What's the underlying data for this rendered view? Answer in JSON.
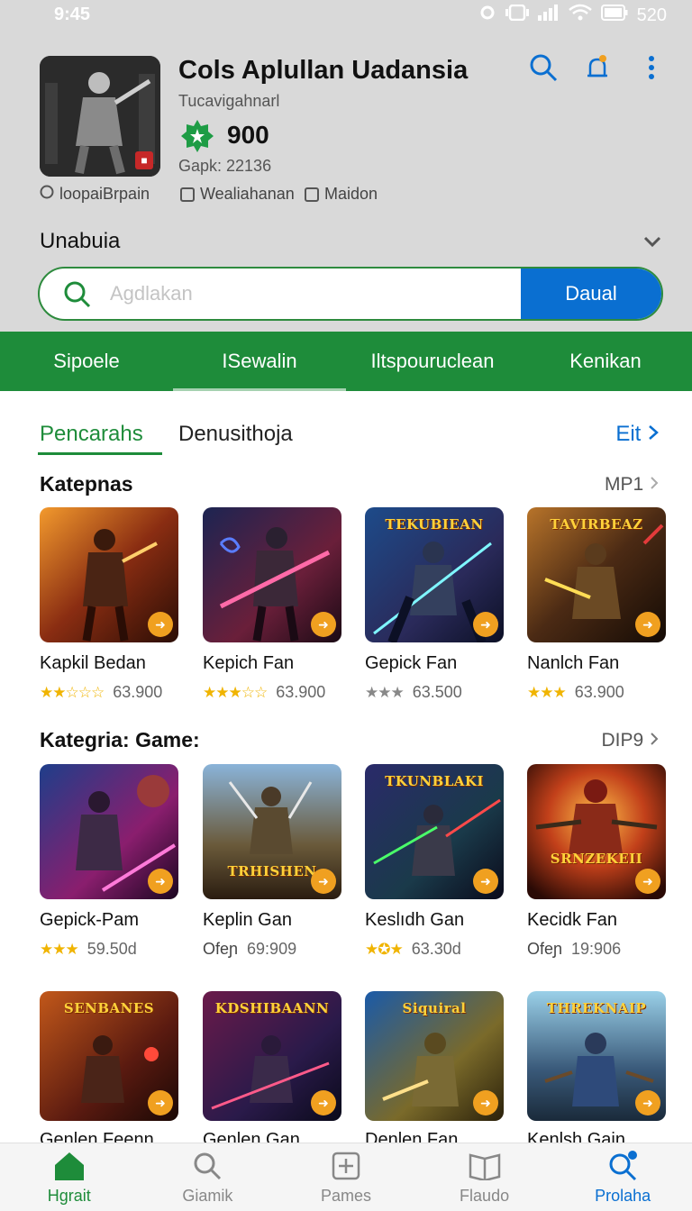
{
  "status_bar": {
    "time": "9:45",
    "battery": "520"
  },
  "app": {
    "title": "Cols Aplullan Uadansia",
    "developer": "Tucavigahnarl",
    "rating": "900",
    "size": "Gapk: 22136",
    "meta_left": "loopaiBrpain",
    "meta_mid": "Wealiahanan",
    "meta_right": "Maidon"
  },
  "header_icons": [
    "search-icon",
    "notification-bell-icon",
    "more-vert-icon"
  ],
  "section_dropdown": {
    "label": "Unabuia"
  },
  "search": {
    "placeholder": "Agdlakan",
    "button_label": "Daual"
  },
  "nav_strip": {
    "items": [
      {
        "label": "Sipoele"
      },
      {
        "label": "ISewalin"
      },
      {
        "label": "Iltspouruclean"
      },
      {
        "label": "Kenikan"
      }
    ]
  },
  "tabs": {
    "items": [
      {
        "label": "Pencarahs"
      },
      {
        "label": "Denusithoja"
      }
    ],
    "link": "Eit"
  },
  "sections": [
    {
      "title": "Katepnas",
      "more": "MP1",
      "items": [
        {
          "name": "Kapkil Bedan",
          "rating": "63.900",
          "stars": "★★☆☆☆"
        },
        {
          "name": "Kepich Fan",
          "rating": "63.900",
          "stars": "★★★☆☆"
        },
        {
          "name": "Gepick Fan",
          "rating": "63.500",
          "stars": "★★★"
        },
        {
          "name": "Nanlch Fan",
          "rating": "63.900",
          "stars": "★★★"
        }
      ]
    },
    {
      "title": "Kategria: Game:",
      "more": "DIP9",
      "items": [
        {
          "name": "Gepick-Pam",
          "rating": "59.50d",
          "stars": "★★★"
        },
        {
          "name": "Keplin Gan",
          "rating": "69:909",
          "prefix": "Ofeɲ"
        },
        {
          "name": "Keslıdh Gan",
          "rating": "63.30d",
          "stars": "★✪★"
        },
        {
          "name": "Kecidk Fan",
          "rating": "19:906",
          "prefix": "Ofeɲ"
        }
      ]
    },
    {
      "title": "",
      "items": [
        {
          "name": "Genlen Feenn",
          "banner": "SENBANES"
        },
        {
          "name": "Genlen Gan",
          "banner": "KDSHIBAANN"
        },
        {
          "name": "Denlen Fan",
          "banner": "Siquiral"
        },
        {
          "name": "Kenlsh Gain",
          "banner": "THREKNAIP"
        }
      ]
    }
  ],
  "banners_row1": [
    "",
    "",
    "TEKUBIEAN",
    "TAVIRBEAZ"
  ],
  "banners_row2": [
    "",
    "TRHISHEN",
    "TKUNBLAKI",
    "SRNZEKEII"
  ],
  "bottom_nav": {
    "items": [
      {
        "label": "Hgrait"
      },
      {
        "label": "Giamik"
      },
      {
        "label": "Pames"
      },
      {
        "label": "Flaudo"
      },
      {
        "label": "Prolaha"
      }
    ]
  },
  "colors": {
    "green": "#1e8c3a",
    "blue": "#0a6fd1",
    "orange": "#f0a020"
  }
}
